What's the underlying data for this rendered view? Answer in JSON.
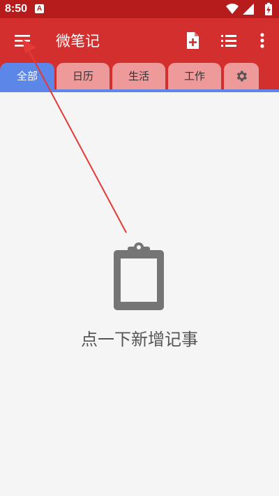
{
  "status_bar": {
    "time": "8:50",
    "notification_badge": "A",
    "icons": [
      "wifi-icon",
      "signal-icon",
      "battery-icon"
    ]
  },
  "app_bar": {
    "title": "微笔记",
    "icons": [
      "menu-icon",
      "new-note-icon",
      "list-view-icon",
      "more-vertical-icon"
    ]
  },
  "tabs": [
    {
      "label": "全部",
      "active": true
    },
    {
      "label": "日历",
      "active": false
    },
    {
      "label": "生活",
      "active": false
    },
    {
      "label": "工作",
      "active": false
    },
    {
      "label": "",
      "icon": "gear-icon",
      "active": false
    }
  ],
  "empty_state": {
    "icon": "clipboard-icon",
    "message": "点一下新增记事"
  },
  "colors": {
    "app_bar": "#d32f2f",
    "status_bar": "#b71c1c",
    "active_tab": "#5c87e8",
    "inactive_tab": "#ef9a9a",
    "annotation_arrow": "#e53935"
  }
}
